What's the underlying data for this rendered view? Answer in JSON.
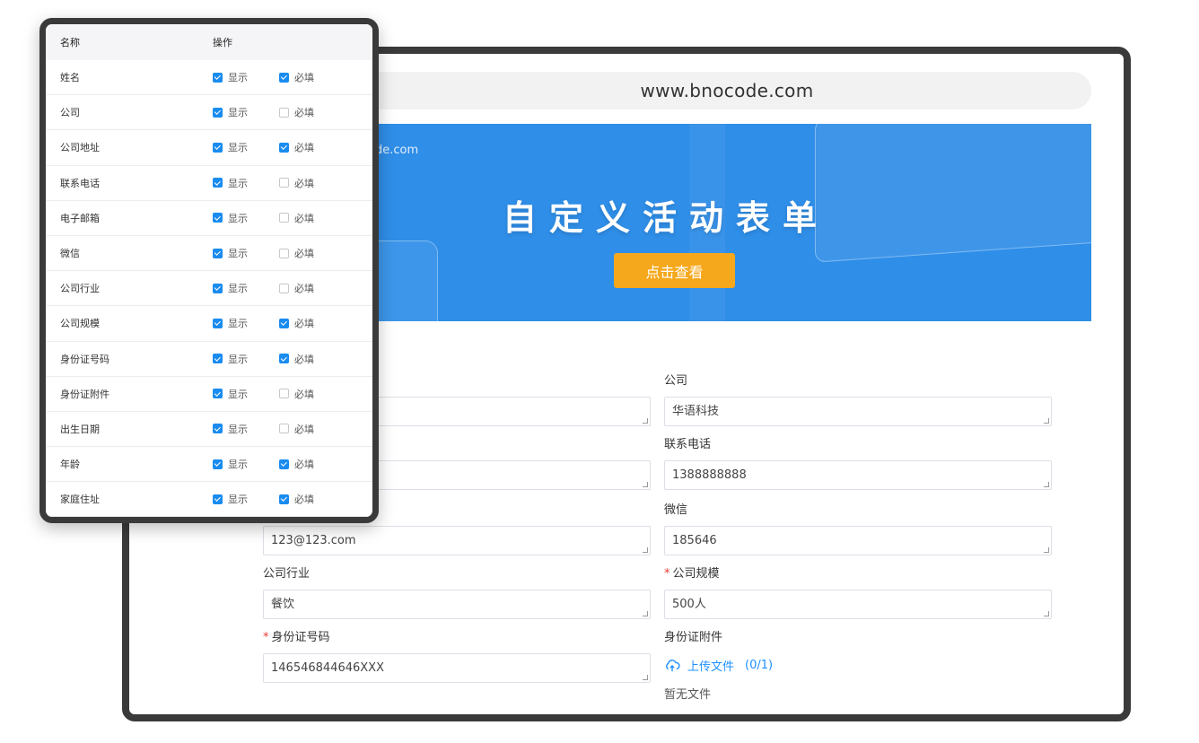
{
  "browser": {
    "url": "www.bnocode.com"
  },
  "banner": {
    "url_fragment": "de.com",
    "title": "自定义活动表单",
    "button_label": "点击查看"
  },
  "form": {
    "fields": [
      {
        "label": "",
        "value": "",
        "required": false
      },
      {
        "label": "公司",
        "value": "华语科技",
        "required": false
      },
      {
        "label": "",
        "value": "",
        "required": false
      },
      {
        "label": "联系电话",
        "value": "1388888888",
        "required": false
      },
      {
        "label": "",
        "value": "123@123.com",
        "required": false
      },
      {
        "label": "微信",
        "value": "185646",
        "required": false
      },
      {
        "label": "公司行业",
        "value": "餐饮",
        "required": false
      },
      {
        "label": "公司规模",
        "value": "500人",
        "required": true
      },
      {
        "label": "身份证号码",
        "value": "146546844646XXX",
        "required": true
      }
    ],
    "attachment": {
      "label": "身份证附件",
      "upload_label": "上传文件",
      "upload_count": "(0/1)",
      "empty_text": "暂无文件"
    }
  },
  "panel": {
    "header": {
      "name": "名称",
      "action": "操作"
    },
    "show_label": "显示",
    "required_label": "必填",
    "rows": [
      {
        "name": "姓名",
        "show": true,
        "required": true
      },
      {
        "name": "公司",
        "show": true,
        "required": false
      },
      {
        "name": "公司地址",
        "show": true,
        "required": true
      },
      {
        "name": "联系电话",
        "show": true,
        "required": false
      },
      {
        "name": "电子邮箱",
        "show": true,
        "required": false
      },
      {
        "name": "微信",
        "show": true,
        "required": false
      },
      {
        "name": "公司行业",
        "show": true,
        "required": false
      },
      {
        "name": "公司规模",
        "show": true,
        "required": true
      },
      {
        "name": "身份证号码",
        "show": true,
        "required": true
      },
      {
        "name": "身份证附件",
        "show": true,
        "required": false
      },
      {
        "name": "出生日期",
        "show": true,
        "required": false
      },
      {
        "name": "年龄",
        "show": true,
        "required": true
      },
      {
        "name": "家庭住址",
        "show": true,
        "required": true
      }
    ]
  },
  "colors": {
    "accent": "#1a8cf0",
    "banner": "#2f8ee8",
    "button": "#f5a81c",
    "required": "#e53935"
  }
}
